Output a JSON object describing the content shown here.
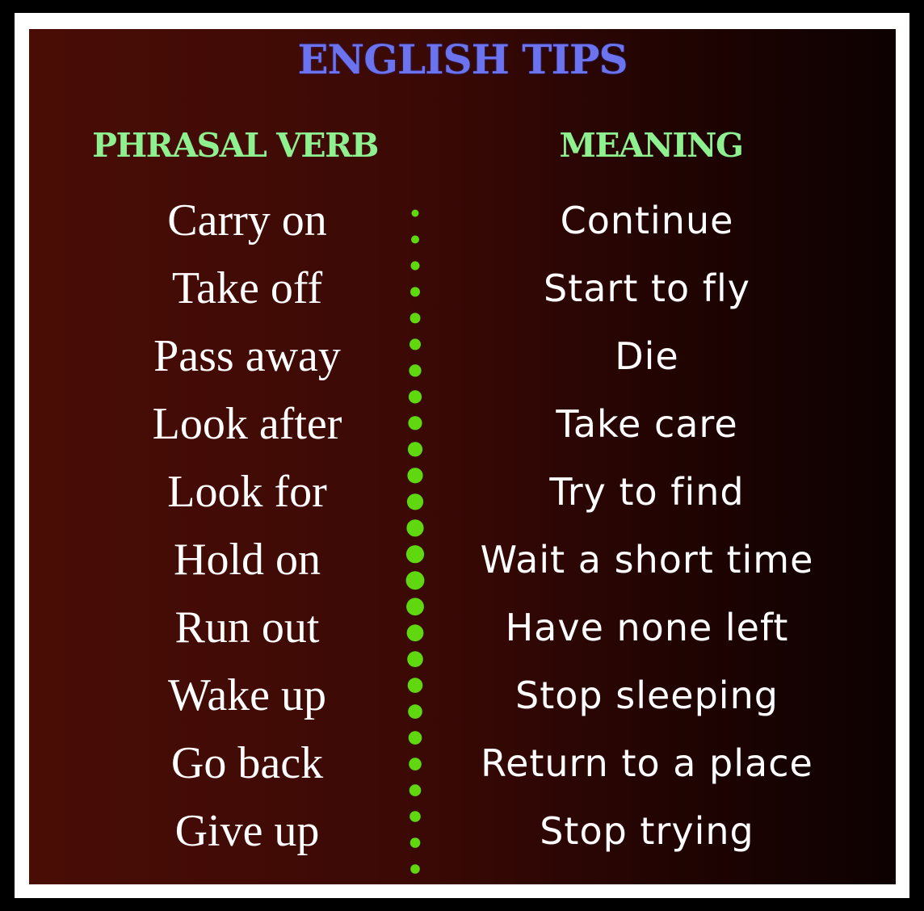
{
  "title": "ENGLISH TIPS",
  "headers": {
    "left": "PHRASAL VERB",
    "right": "MEANING"
  },
  "colors": {
    "title": "#6b73ee",
    "header": "#8ef08e",
    "dots": "#5fd80f",
    "text": "#ffffff"
  },
  "rows": [
    {
      "verb": "Carry on",
      "meaning": "Continue"
    },
    {
      "verb": "Take off",
      "meaning": "Start to fly"
    },
    {
      "verb": "Pass away",
      "meaning": "Die"
    },
    {
      "verb": "Look after",
      "meaning": "Take care"
    },
    {
      "verb": "Look for",
      "meaning": "Try to find"
    },
    {
      "verb": "Hold on",
      "meaning": "Wait a short time"
    },
    {
      "verb": "Run out",
      "meaning": "Have none left"
    },
    {
      "verb": "Wake up",
      "meaning": "Stop sleeping"
    },
    {
      "verb": "Go back",
      "meaning": "Return to a place"
    },
    {
      "verb": "Give up",
      "meaning": "Stop trying"
    }
  ]
}
